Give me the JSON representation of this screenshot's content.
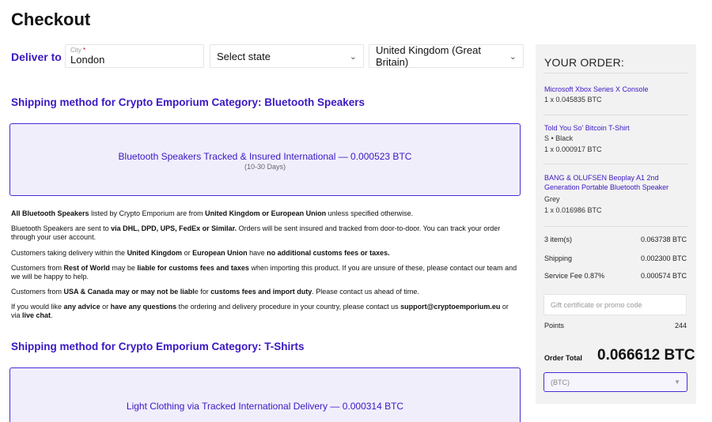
{
  "page": {
    "title": "Checkout"
  },
  "deliver": {
    "label": "Deliver to",
    "city_label": "City",
    "city_required": "*",
    "city_value": "London",
    "state_value": "Select state",
    "country_value": "United Kingdom (Great Britain)"
  },
  "sections": [
    {
      "heading": "Shipping method for Crypto Emporium Category: Bluetooth Speakers",
      "option_title": "Bluetooth Speakers Tracked & Insured International — 0.000523 BTC",
      "option_sub": "(10-30 Days)"
    },
    {
      "heading": "Shipping method for Crypto Emporium Category: T-Shirts",
      "option_title": "Light Clothing via Tracked International Delivery — 0.000314 BTC",
      "option_sub": ""
    }
  ],
  "info": {
    "p1": {
      "b1": "All Bluetooth Speakers",
      "t1": " listed by Crypto Emporium are from ",
      "b2": "United Kingdom or European Union",
      "t2": " unless specified otherwise."
    },
    "p2": {
      "t1": "Bluetooth Speakers are sent to ",
      "b1": "via DHL, DPD, UPS, FedEx or Similar.",
      "t2": " Orders will be sent insured and tracked from door-to-door. You can track your order through your user account."
    },
    "p3": {
      "t1": "Customers taking delivery within the ",
      "b1": "United Kingdom",
      "t2": " or ",
      "b2": "European Union",
      "t3": " have ",
      "b3": "no additional customs fees or taxes."
    },
    "p4": {
      "t1": "Customers from ",
      "b1": "Rest of World",
      "t2": " may be ",
      "b2": "liable for customs fees and taxes",
      "t3": " when importing this product. If you are unsure of these, please contact our team and we will be happy to help."
    },
    "p5": {
      "t1": "Customers from ",
      "b1": "USA & Canada may or may not be liabl",
      "t2": "e for ",
      "b2": "customs fees and import duty",
      "t3": ". Please contact us ahead of time."
    },
    "p6": {
      "t1": "If you would like ",
      "b1": "any advice",
      "t2": " or ",
      "b2": "have any questions",
      "t3": " the ordering and delivery procedure in your country, please contact us ",
      "b3": "support@cryptoemporium.eu",
      "t4": " or via ",
      "b4": "live chat",
      "t5": "."
    }
  },
  "order": {
    "title": "YOUR ORDER:",
    "items": [
      {
        "name": "Microsoft Xbox Series X Console",
        "variant": "",
        "qty": "1 x 0.045835 BTC"
      },
      {
        "name": "Told You So' Bitcoin T-Shirt",
        "variant": "S • Black",
        "qty": "1 x 0.000917 BTC"
      },
      {
        "name": "BANG & OLUFSEN Beoplay A1 2nd Generation Portable Bluetooth Speaker",
        "variant": "Grey",
        "qty": "1 x 0.016986 BTC"
      }
    ],
    "summary": {
      "items_label": "3 item(s)",
      "items_value": "0.063738 BTC",
      "shipping_label": "Shipping",
      "shipping_value": "0.002300 BTC",
      "fee_label": "Service Fee 0.87%",
      "fee_value": "0.000574 BTC"
    },
    "promo_placeholder": "Gift certificate or promo code",
    "points_label": "Points",
    "points_value": "244",
    "total_label": "Order Total",
    "total_value": "0.066612 BTC",
    "currency_value": "(BTC)"
  },
  "colors": {
    "accent": "#3b18c2",
    "option_bg": "#f1eefc",
    "panel_bg": "#f2f2f2"
  }
}
